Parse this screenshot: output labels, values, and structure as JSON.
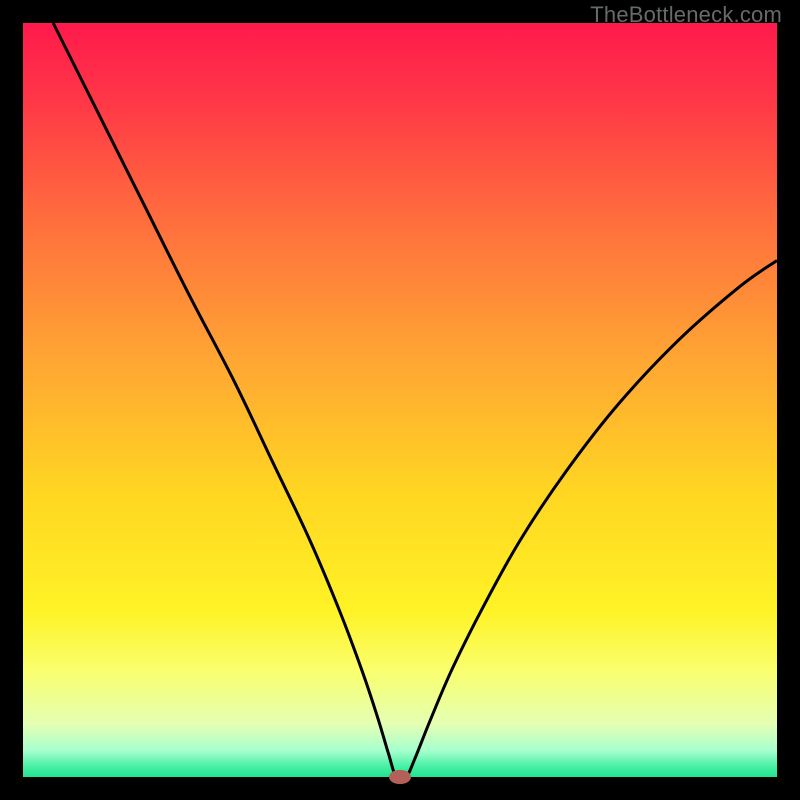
{
  "watermark": "TheBottleneck.com",
  "chart_data": {
    "type": "line",
    "title": "",
    "xlabel": "",
    "ylabel": "",
    "xlim": [
      0,
      100
    ],
    "ylim": [
      0,
      100
    ],
    "background_gradient": {
      "stops": [
        {
          "pos": 0.0,
          "color": "#ff1a4c"
        },
        {
          "pos": 0.1,
          "color": "#ff3647"
        },
        {
          "pos": 0.25,
          "color": "#ff6a3e"
        },
        {
          "pos": 0.45,
          "color": "#ffa733"
        },
        {
          "pos": 0.62,
          "color": "#ffd522"
        },
        {
          "pos": 0.78,
          "color": "#fff326"
        },
        {
          "pos": 0.86,
          "color": "#f9ff6e"
        },
        {
          "pos": 0.93,
          "color": "#e4ffb4"
        },
        {
          "pos": 0.965,
          "color": "#a6ffce"
        },
        {
          "pos": 0.985,
          "color": "#4cf0a6"
        },
        {
          "pos": 1.0,
          "color": "#1ee68f"
        }
      ]
    },
    "series": [
      {
        "name": "bottleneck-curve",
        "color": "#000000",
        "points": [
          {
            "x": 4.0,
            "y": 100.0
          },
          {
            "x": 10.0,
            "y": 88.0
          },
          {
            "x": 16.0,
            "y": 76.0
          },
          {
            "x": 22.0,
            "y": 64.0
          },
          {
            "x": 28.0,
            "y": 52.5
          },
          {
            "x": 33.0,
            "y": 42.0
          },
          {
            "x": 38.0,
            "y": 31.5
          },
          {
            "x": 42.0,
            "y": 22.0
          },
          {
            "x": 45.0,
            "y": 14.0
          },
          {
            "x": 47.0,
            "y": 8.0
          },
          {
            "x": 48.5,
            "y": 3.0
          },
          {
            "x": 49.5,
            "y": 0.0
          },
          {
            "x": 50.8,
            "y": 0.0
          },
          {
            "x": 52.0,
            "y": 2.5
          },
          {
            "x": 54.0,
            "y": 7.5
          },
          {
            "x": 57.0,
            "y": 14.5
          },
          {
            "x": 61.0,
            "y": 22.5
          },
          {
            "x": 66.0,
            "y": 31.5
          },
          {
            "x": 72.0,
            "y": 40.5
          },
          {
            "x": 79.0,
            "y": 49.5
          },
          {
            "x": 87.0,
            "y": 58.0
          },
          {
            "x": 95.0,
            "y": 65.0
          },
          {
            "x": 100.0,
            "y": 68.5
          }
        ]
      }
    ],
    "markers": [
      {
        "name": "min-marker",
        "x": 50.0,
        "y": 0.0,
        "color": "#b26058",
        "rx": 1.4,
        "ry": 0.95
      }
    ]
  }
}
